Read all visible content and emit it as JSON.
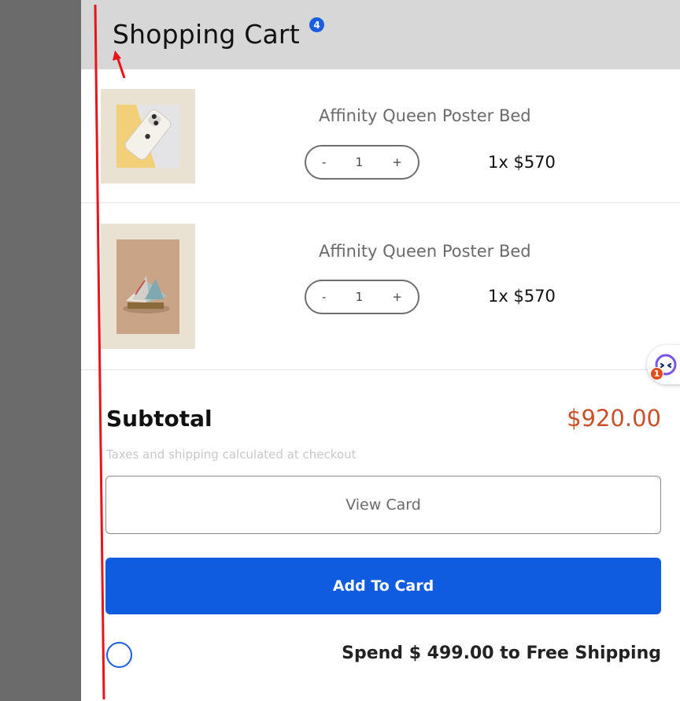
{
  "cart": {
    "title": "Shopping Cart",
    "count": "4",
    "items": [
      {
        "name": "Affinity Queen Poster Bed",
        "qty_minus": "-",
        "qty_value": "1",
        "qty_plus": "+",
        "price": "1x $570",
        "image": "phone-product-image"
      },
      {
        "name": "Affinity Queen Poster Bed",
        "qty_minus": "-",
        "qty_value": "1",
        "qty_plus": "+",
        "price": "1x $570",
        "image": "book-product-image"
      }
    ],
    "subtotal_label": "Subtotal",
    "subtotal_value": "$920.00",
    "tax_note": "Taxes and shipping calculated at checkout",
    "view_button": "View Card",
    "add_button": "Add To Card",
    "shipping_text": "Spend $ 499.00 to Free Shipping"
  },
  "chat": {
    "badge": "1",
    "icon": "chat-bot-icon"
  },
  "colors": {
    "accent": "#0f5ce0",
    "price": "#c9502a",
    "overlay": "#6b6b6b",
    "header_bg": "#d7d7d7"
  }
}
